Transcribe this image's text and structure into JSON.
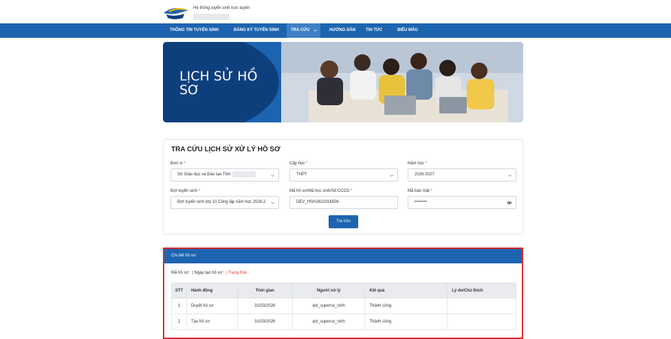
{
  "header": {
    "site_title": "Hệ thống tuyển sinh trực tuyến",
    "colors": {
      "primary": "#1d64b0",
      "dark": "#0e3f7d",
      "required": "#e53935",
      "highlight_border": "#e0242b"
    }
  },
  "nav": {
    "items": [
      {
        "label": "THÔNG TIN TUYỂN SINH"
      },
      {
        "label": "ĐĂNG KÝ TUYỂN SINH"
      },
      {
        "label": "TRA CỨU"
      },
      {
        "label": "HƯỚNG DẪN"
      },
      {
        "label": "TIN TỨC"
      },
      {
        "label": "BIỂU MẪU"
      }
    ],
    "active_index": 2
  },
  "banner": {
    "title": "LỊCH SỬ HỒ SƠ"
  },
  "search": {
    "title": "TRA CỨU LỊCH SỬ XỬ LÝ HỒ SƠ",
    "fields": {
      "don_vi": {
        "label": "Đơn vị",
        "value": "Sở Giáo dục và Đào tạo Tỉnh"
      },
      "cap_hoc": {
        "label": "Cấp học",
        "value": "THPT"
      },
      "nam_hoc": {
        "label": "Năm học",
        "value": "2026-2027"
      },
      "dot_tuyen_sinh": {
        "label": "Đợt tuyển sinh",
        "value": "Đợt tuyển sinh lớp 10 Công lập năm học 2026-2"
      },
      "ma_ho_so": {
        "label": "Mã hồ sơ/Mã học sinh/Số CCCD",
        "value": "DEV_HSH2622016506"
      },
      "ma_bao_mat": {
        "label": "Mã bảo mật",
        "value": "•••••••"
      }
    },
    "required_mark": "*",
    "submit_label": "Tra cứu"
  },
  "detail": {
    "header": "Chi tiết hồ sơ",
    "meta": {
      "ma_ho_so": "Mã hồ sơ:",
      "ngay_tao": "| Ngày tạo hồ sơ:",
      "trang_thai": "| Trạng thái:"
    },
    "columns": [
      "STT",
      "Hành động",
      "Thời gian",
      "Người xử lý",
      "Kết quả",
      "Lý do/Chú thích"
    ],
    "rows": [
      {
        "stt": "1",
        "hanh_dong": "Duyệt hồ sơ",
        "thoi_gian": "31/03/2026",
        "nguoi_xu_ly": "qni_superso_ninh",
        "ket_qua": "Thành công",
        "ly_do": ""
      },
      {
        "stt": "2",
        "hanh_dong": "Tạo hồ sơ",
        "thoi_gian": "31/03/2026",
        "nguoi_xu_ly": "qni_superso_ninh",
        "ket_qua": "Thành công",
        "ly_do": ""
      }
    ]
  },
  "icons": {
    "logo": "graduation-cap-icon",
    "select_arrow": "chevron-down-icon",
    "show_password": "eye-icon"
  }
}
